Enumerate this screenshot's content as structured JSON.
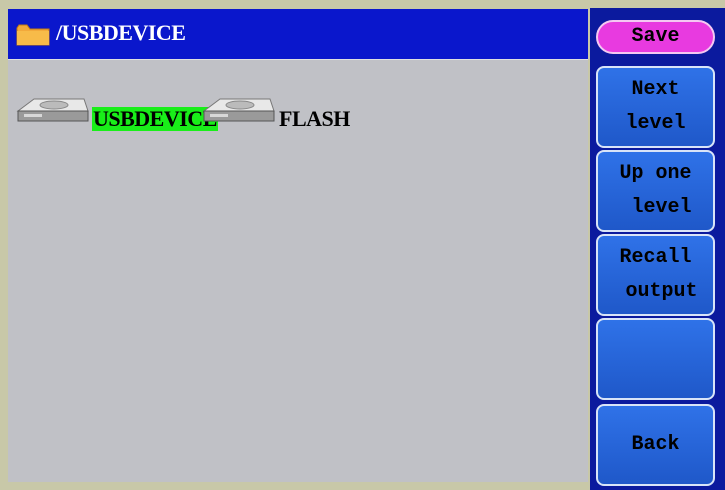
{
  "header": {
    "path": "/USBDEVICE",
    "folder_icon": "folder-icon"
  },
  "drives": [
    {
      "label": "USBDEVICE",
      "selected": true,
      "icon": "drive-icon"
    },
    {
      "label": "FLASH",
      "selected": false,
      "icon": "drive-icon"
    }
  ],
  "menu": {
    "save": "Save",
    "next_level": "Next\nlevel",
    "up_one_level": "Up one\n level",
    "recall_output": "Recall\n output",
    "blank": "",
    "back": "Back"
  },
  "colors": {
    "title_bar": "#0a17cc",
    "panel": "#c0c1c6",
    "selected": "#19ee19",
    "menu_button": "#2f72e8",
    "save_button": "#e83ae0"
  }
}
